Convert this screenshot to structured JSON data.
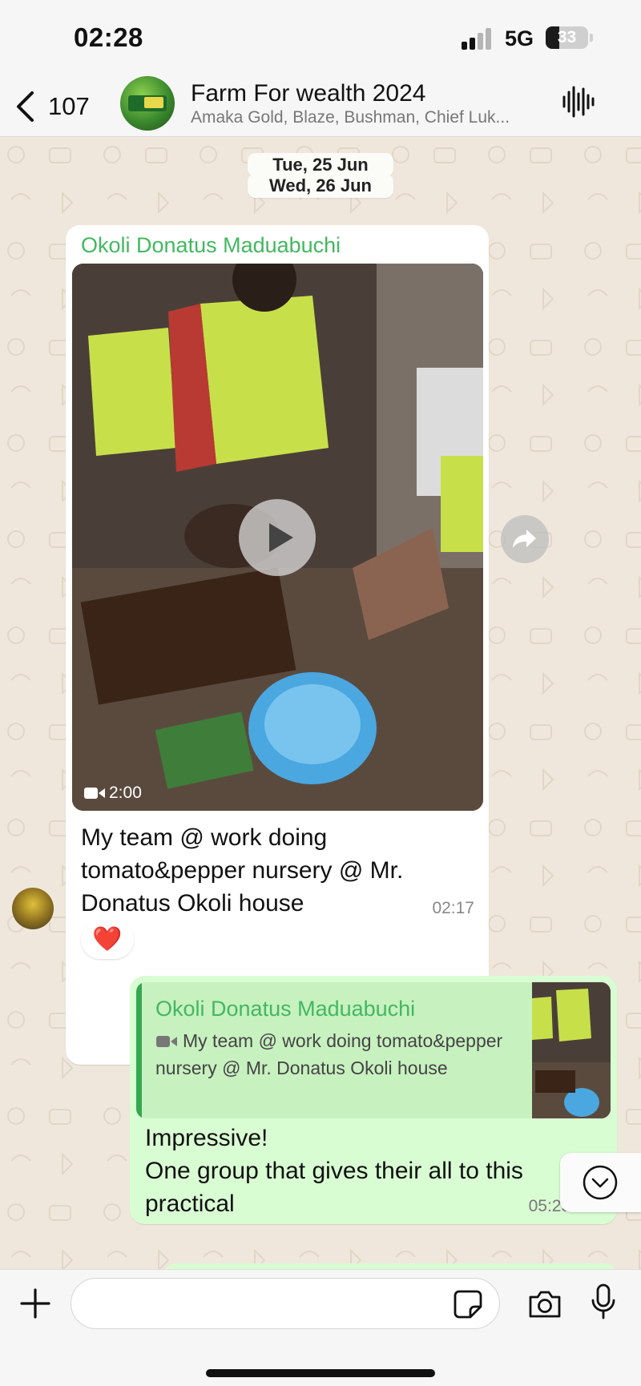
{
  "status_bar": {
    "time": "02:28",
    "network": "5G",
    "battery": "33",
    "battery_level": 0.33
  },
  "header": {
    "back_count": "107",
    "title": "Farm For wealth 2024",
    "subtitle": "Amaka Gold, Blaze, Bushman, Chief Luk...",
    "icons": [
      "chevron-left-icon",
      "waveform-icon"
    ]
  },
  "chat": {
    "date_chips": [
      "Tue, 25 Jun",
      "Wed, 26 Jun"
    ],
    "incoming": {
      "sender": "Okoli Donatus Maduabuchi",
      "video_duration": "2:00",
      "caption": "My team @ work doing tomato&pepper nursery @ Mr. Donatus Okoli house",
      "time": "02:17",
      "reaction": "❤️"
    },
    "outgoing": {
      "reply_to_sender": "Okoli Donatus Maduabuchi",
      "reply_to_text": "My team @ work doing tomato&pepper nursery @ Mr. Donatus Okoli house",
      "text_line1": "Impressive!",
      "text_line2": "One group that gives their all to this practical",
      "time": "05:25",
      "status_icon": "check-icon"
    }
  },
  "input_bar": {
    "placeholder": "",
    "icons": [
      "plus-icon",
      "sticker-icon",
      "camera-icon",
      "microphone-icon"
    ]
  },
  "colors": {
    "sender_name": "#43b860",
    "outgoing_bubble": "#d9fdd3",
    "chat_background": "#efe7dc"
  }
}
